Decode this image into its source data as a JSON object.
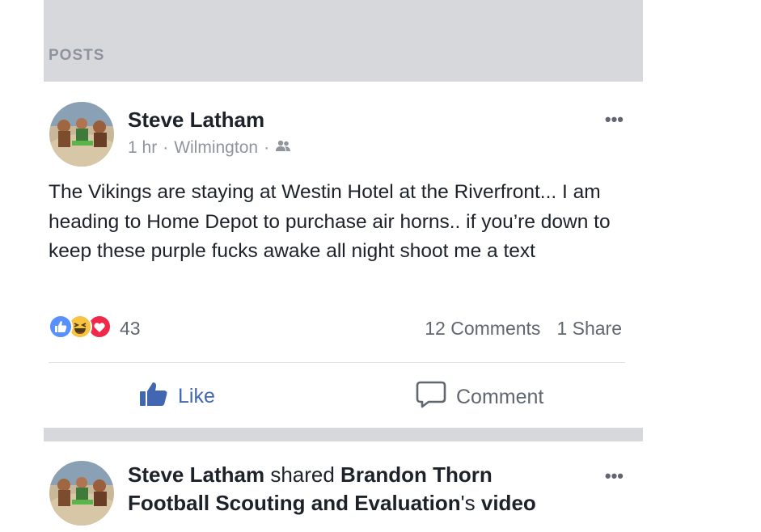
{
  "section": {
    "label": "POSTS"
  },
  "posts": [
    {
      "author": "Steve Latham",
      "time": "1 hr",
      "location": "Wilmington",
      "audience_icon": "friends-icon",
      "text": "The Vikings are staying at Westin Hotel at the Riverfront... I am heading to Home Depot to purchase air horns.. if you’re down to keep these purple fucks awake all night shoot me a text",
      "reaction_icons": [
        "like-reaction-icon",
        "haha-reaction-icon",
        "love-reaction-icon"
      ],
      "reaction_count": "43",
      "comments": "12 Comments",
      "shares": "1 Share",
      "actions": {
        "like": "Like",
        "comment": "Comment"
      }
    },
    {
      "author": "Steve Latham",
      "shared_word": "shared",
      "shared_page": "Brandon Thorn Football Scouting and Evaluation",
      "possessive": "'s",
      "object": "video"
    }
  ],
  "colors": {
    "brand_blue": "#4267b2",
    "band_gray": "#d7d8dc",
    "meta_gray": "#90949c",
    "love_red": "#f0284a",
    "haha_yellow": "#f7c340"
  }
}
